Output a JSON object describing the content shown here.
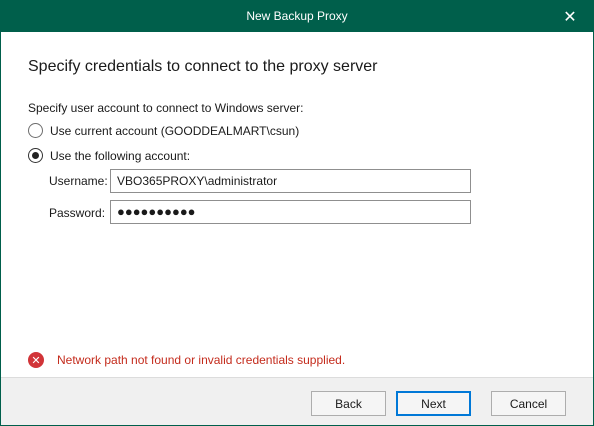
{
  "window": {
    "title": "New Backup Proxy",
    "close_glyph": "✕"
  },
  "heading": "Specify credentials to connect to the proxy server",
  "account_section": {
    "label": "Specify user account to connect to Windows server:",
    "options": [
      {
        "label": "Use current account (GOODDEALMART\\csun)",
        "selected": false
      },
      {
        "label": "Use the following account:",
        "selected": true
      }
    ]
  },
  "credentials": {
    "username_label": "Username:",
    "username_value": "VBO365PROXY\\administrator",
    "password_label": "Password:",
    "password_mask": "●●●●●●●●●●"
  },
  "error": {
    "icon": "error-x-icon",
    "glyph": "✕",
    "message": "Network path not found or invalid credentials supplied."
  },
  "buttons": {
    "back": "Back",
    "next": "Next",
    "cancel": "Cancel"
  },
  "colors": {
    "titlebar": "#005f4b",
    "error": "#c42b1c",
    "accent": "#0078d7"
  }
}
